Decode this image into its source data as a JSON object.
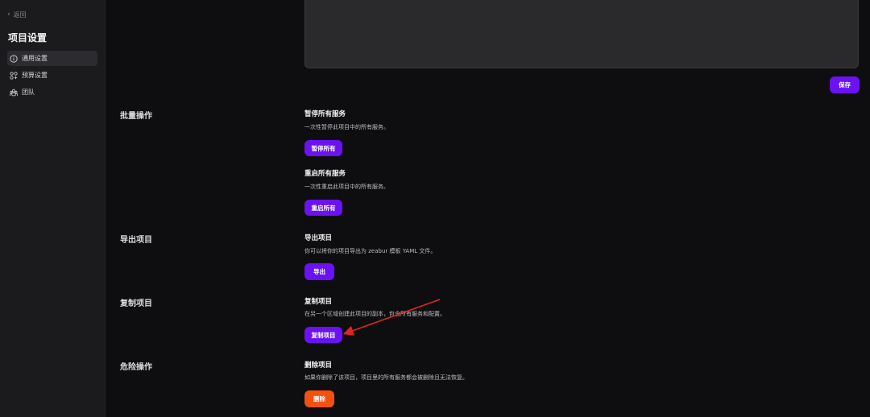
{
  "sidebar": {
    "back_label": "返回",
    "title": "项目设置",
    "items": [
      {
        "label": "通用设置",
        "icon": "info-circle-icon",
        "active": true
      },
      {
        "label": "预算设置",
        "icon": "grid-icon",
        "active": false
      },
      {
        "label": "团队",
        "icon": "team-icon",
        "active": false
      }
    ]
  },
  "main": {
    "save_label": "保存",
    "sections": {
      "bulk": {
        "label": "批量操作",
        "pause": {
          "title": "暂停所有服务",
          "desc": "一次性暂停此项目中的所有服务。",
          "button": "暂停所有"
        },
        "restart": {
          "title": "重启所有服务",
          "desc": "一次性重启此项目中的所有服务。",
          "button": "重启所有"
        }
      },
      "export": {
        "label": "导出项目",
        "title": "导出项目",
        "desc": "你可以将你的项目导出为 zeabur 模板 YAML 文件。",
        "button": "导出"
      },
      "copy": {
        "label": "复制项目",
        "title": "复制项目",
        "desc": "在另一个区域创建此项目的副本，包含所有服务和配置。",
        "button": "复制项目"
      },
      "danger": {
        "label": "危险操作",
        "title": "删除项目",
        "desc": "如果你删除了该项目，项目里的所有服务都会被删除且无法恢复。",
        "button": "删除"
      }
    }
  },
  "colors": {
    "accent": "#6a12f2",
    "danger": "#f2510f",
    "annotation": "#e02424"
  }
}
